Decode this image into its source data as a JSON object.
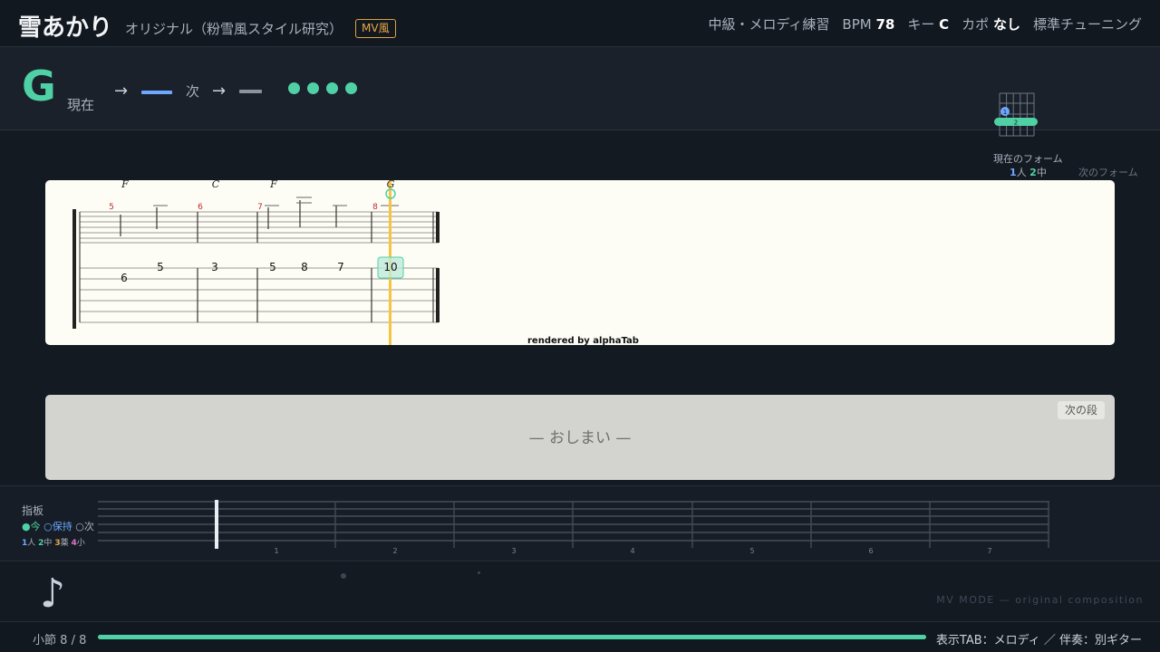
{
  "header": {
    "title": "雪あかり",
    "subtitle": "オリジナル（粉雪風スタイル研究）",
    "badge": "MV風",
    "mode_label": "中級・メロディ練習",
    "bpm_label": "BPM",
    "bpm_value": "78",
    "key_label": "キー",
    "key_value": "C",
    "capo_label": "カポ",
    "capo_value": "なし",
    "tuning": "標準チューニング"
  },
  "chord_bar": {
    "current_chord": "G",
    "current_label": "現在",
    "arrow": "→",
    "next_label": "次",
    "beats_total": 4,
    "beats_lit": 4,
    "diagram_finger_1": "1",
    "diagram_finger_2": "2",
    "current_form_label": "現在のフォーム",
    "legend_1_num": "1",
    "legend_1_text": "人",
    "legend_2_num": "2",
    "legend_2_text": "中",
    "next_form_label": "次のフォーム"
  },
  "score": {
    "chords": [
      "F",
      "C",
      "F",
      "G"
    ],
    "measure_numbers": [
      "5",
      "6",
      "7",
      "8"
    ],
    "tab_notes": [
      "6",
      "5",
      "3",
      "5",
      "8",
      "7",
      "10"
    ],
    "rendered_by": "rendered by alphaTab"
  },
  "next_section": {
    "end_text": "— おしまい —",
    "badge": "次の段"
  },
  "fretboard": {
    "title": "指板",
    "legend_now": "●今",
    "legend_hold": "○保持",
    "legend_next": "○次",
    "fingers": [
      {
        "num": "1",
        "name": "人"
      },
      {
        "num": "2",
        "name": "中"
      },
      {
        "num": "3",
        "name": "薬"
      },
      {
        "num": "4",
        "name": "小"
      }
    ],
    "fret_numbers": [
      "1",
      "2",
      "3",
      "4",
      "5",
      "6",
      "7"
    ]
  },
  "footer": {
    "note_icon": "♪",
    "mv_mode": "MV MODE — original composition",
    "measure_label": "小節",
    "measure_current": "8",
    "measure_total": "8",
    "progress": 1.0,
    "display_info": "表示TAB：メロディ ／ 伴奏：別ギター"
  },
  "colors": {
    "accent": "#4fd1a5",
    "finger_1": "#6ea8ff",
    "finger_2": "#4fd1a5",
    "finger_3": "#e6a848",
    "finger_4": "#e070d0",
    "cursor": "#f5c542",
    "badge": "#e6a848"
  }
}
